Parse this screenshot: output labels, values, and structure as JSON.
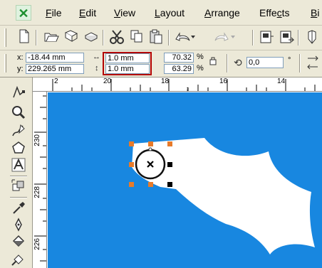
{
  "menu": {
    "items": [
      {
        "label": "File",
        "key": "F",
        "rest": "ile"
      },
      {
        "label": "Edit",
        "key": "E",
        "rest": "dit"
      },
      {
        "label": "View",
        "key": "V",
        "rest": "iew"
      },
      {
        "label": "Layout",
        "key": "L",
        "rest": "ayout"
      },
      {
        "label": "Arrange",
        "key": "A",
        "rest": "rrange"
      },
      {
        "label": "Effects",
        "pre": "Effe",
        "key": "c",
        "rest": "ts"
      },
      {
        "label": "Bi",
        "key": "B",
        "rest": "i"
      }
    ]
  },
  "propbar": {
    "x_label": "x:",
    "x_value": "-18.44 mm",
    "y_label": "y:",
    "y_value": "229.265 mm",
    "width_value": "1.0 mm",
    "height_value": "1.0 mm",
    "scale_x": "70.32",
    "scale_y": "63.29",
    "percent": "%",
    "rotation_value": "0,0",
    "degree": "°"
  },
  "rulers": {
    "h_labels": [
      "2",
      "20",
      "18",
      "16",
      "14"
    ],
    "v_labels": [
      "230",
      "228",
      "226"
    ]
  },
  "colors": {
    "canvas": "#1887e0",
    "shape": "#ffffff",
    "handle_orange": "#e87b2a",
    "handle_black": "#000000",
    "highlight": "#b30000"
  }
}
